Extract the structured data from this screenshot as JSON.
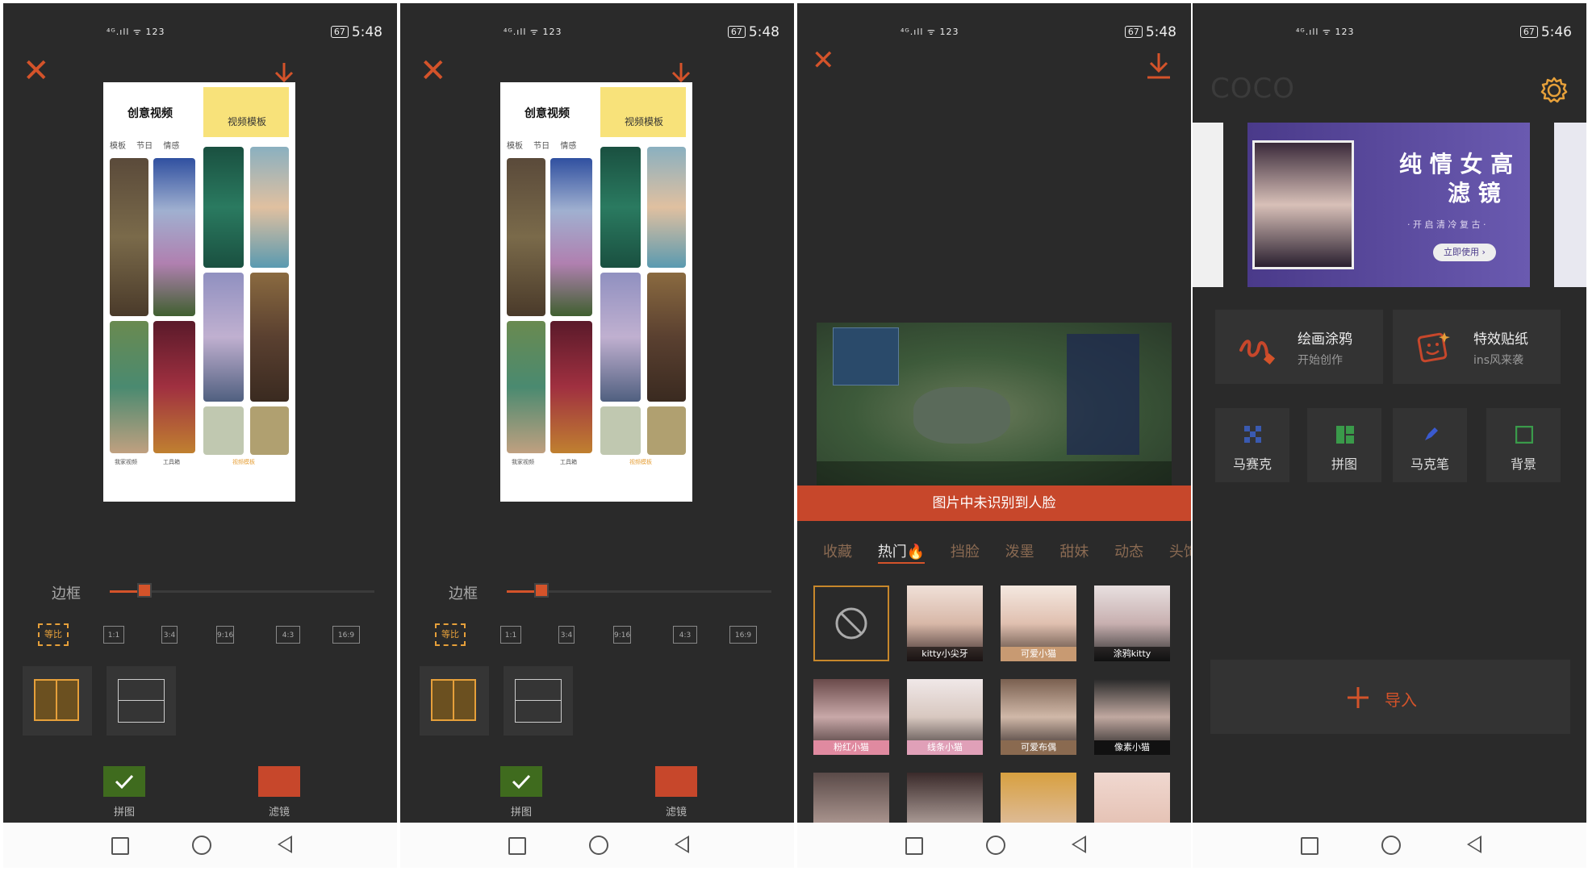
{
  "status": {
    "signal": "⁴ᴳ.ıll ᯤ 123",
    "battery": "67",
    "time_a": "5:48",
    "time_b": "5:46"
  },
  "editor": {
    "thumb_title": "创意视频",
    "thumb_yellow": "视频模板",
    "thumb_tabs": "模板 节日 情感",
    "thumb_nav": [
      "我家视频",
      "工具箱",
      "视频模板"
    ],
    "slider_label": "边框",
    "slider_value": 0.13,
    "ratios": [
      "等比",
      "1:1",
      "3:4",
      "9:16",
      "4:3",
      "16:9"
    ],
    "confirm_label": "拼图",
    "filter_label": "滤镜"
  },
  "face": {
    "banner": "图片中未识别到人脸",
    "tabs": [
      "收藏",
      "热门🔥",
      "挡脸",
      "泼墨",
      "甜妹",
      "动态",
      "头饰"
    ],
    "stickers": [
      "kitty小尖牙",
      "可爱小猫",
      "涂鸦kitty",
      "粉红小猫",
      "线条小猫",
      "可爱布偶",
      "像素小猫"
    ]
  },
  "home": {
    "logo": "COCO",
    "banner_title_1": "纯 情 女 高",
    "banner_title_2": "滤 镜",
    "banner_sub": "· 开 启 清 冷 复 古 ·",
    "banner_btn": "立即使用 ›",
    "cards": [
      {
        "title": "绘画涂鸦",
        "sub": "开始创作"
      },
      {
        "title": "特效贴纸",
        "sub": "ins风来袭"
      }
    ],
    "tools": [
      "马赛克",
      "拼图",
      "马克笔",
      "背景"
    ],
    "import_label": "导入"
  },
  "colors": {
    "accent": "#d4532a",
    "panel": "#2a2a2a",
    "card": "#333333",
    "confirm": "#3f6b1e"
  }
}
